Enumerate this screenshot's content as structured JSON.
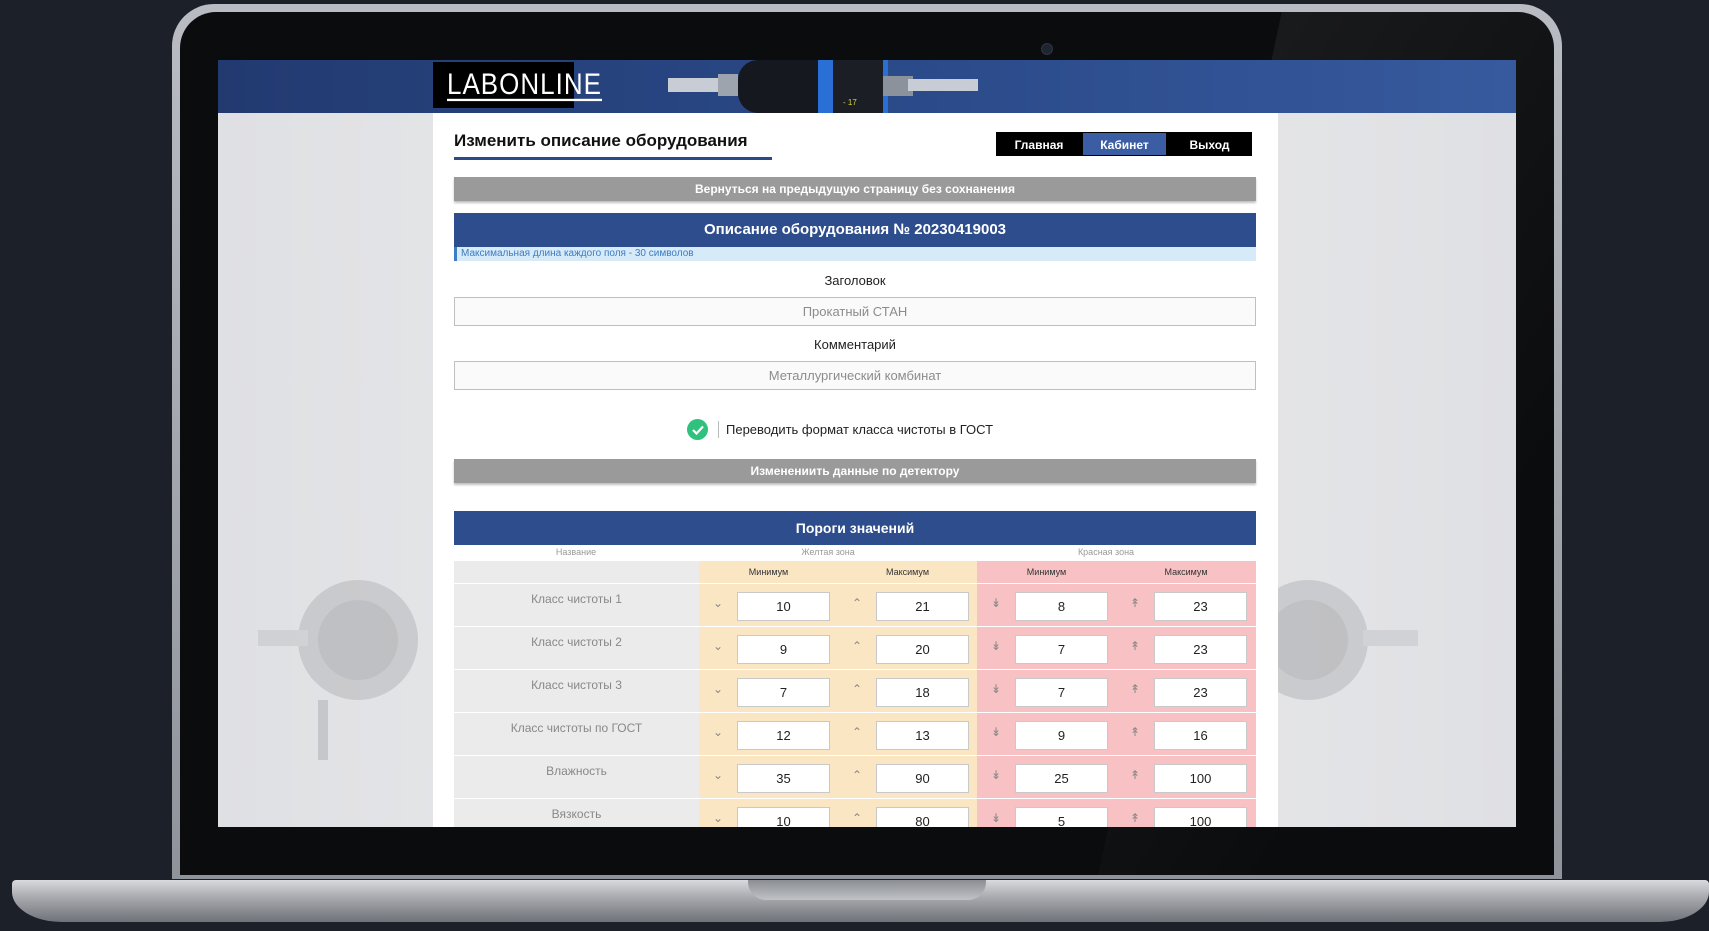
{
  "brand": {
    "logo_text": "LABONLINE"
  },
  "nav": {
    "home": "Главная",
    "cabinet": "Кабинет",
    "exit": "Выход"
  },
  "page": {
    "title": "Изменить описание оборудования",
    "back_button": "Вернуться на предыдущую страницу без сохнанения",
    "description_header": "Описание оборудования № 20230419003",
    "note": "Максимальная длина каждого поля - 30 символов",
    "heading_label": "Заголовок",
    "heading_value": "Прокатный СТАН",
    "comment_label": "Комментарий",
    "comment_value": "Металлургический комбинат",
    "gost_checkbox_label": "Переводить формат класса чистоты в ГОСТ",
    "gost_checked": true,
    "detector_button": "Изменениить данные по детектору"
  },
  "thresholds": {
    "header": "Пороги значений",
    "col_name": "Название",
    "col_yellow": "Желтая зона",
    "col_red": "Красная зона",
    "min_label": "Минимум",
    "max_label": "Максимум",
    "colors": {
      "yellow_zone": "#fbe6c4",
      "red_zone": "#f8c2c4",
      "accent": "#2e4d8c"
    },
    "rows": [
      {
        "name": "Класс чистоты 1",
        "y_min": "10",
        "y_max": "21",
        "r_min": "8",
        "r_max": "23"
      },
      {
        "name": "Класс чистоты 2",
        "y_min": "9",
        "y_max": "20",
        "r_min": "7",
        "r_max": "23"
      },
      {
        "name": "Класс чистоты 3",
        "y_min": "7",
        "y_max": "18",
        "r_min": "7",
        "r_max": "23"
      },
      {
        "name": "Класс чистоты по ГОСТ",
        "y_min": "12",
        "y_max": "13",
        "r_min": "9",
        "r_max": "16"
      },
      {
        "name": "Влажность",
        "y_min": "35",
        "y_max": "90",
        "r_min": "25",
        "r_max": "100"
      },
      {
        "name": "Вязкость",
        "y_min": "10",
        "y_max": "80",
        "r_min": "5",
        "r_max": "100"
      }
    ]
  }
}
